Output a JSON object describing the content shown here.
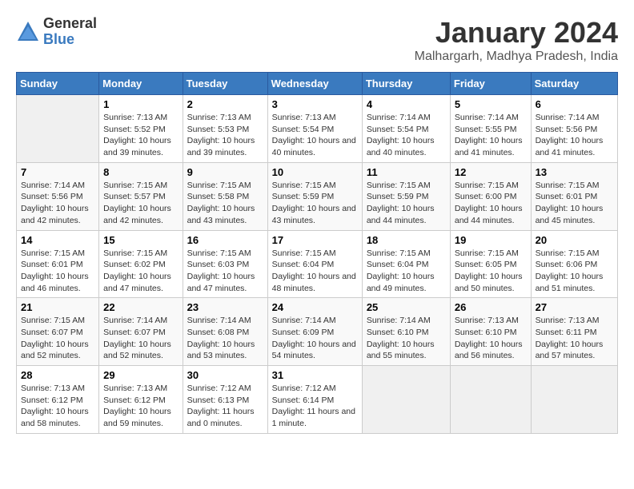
{
  "logo": {
    "general": "General",
    "blue": "Blue"
  },
  "title": "January 2024",
  "subtitle": "Malhargarh, Madhya Pradesh, India",
  "headers": [
    "Sunday",
    "Monday",
    "Tuesday",
    "Wednesday",
    "Thursday",
    "Friday",
    "Saturday"
  ],
  "weeks": [
    [
      {
        "day": "",
        "sunrise": "",
        "sunset": "",
        "daylight": ""
      },
      {
        "day": "1",
        "sunrise": "Sunrise: 7:13 AM",
        "sunset": "Sunset: 5:52 PM",
        "daylight": "Daylight: 10 hours and 39 minutes."
      },
      {
        "day": "2",
        "sunrise": "Sunrise: 7:13 AM",
        "sunset": "Sunset: 5:53 PM",
        "daylight": "Daylight: 10 hours and 39 minutes."
      },
      {
        "day": "3",
        "sunrise": "Sunrise: 7:13 AM",
        "sunset": "Sunset: 5:54 PM",
        "daylight": "Daylight: 10 hours and 40 minutes."
      },
      {
        "day": "4",
        "sunrise": "Sunrise: 7:14 AM",
        "sunset": "Sunset: 5:54 PM",
        "daylight": "Daylight: 10 hours and 40 minutes."
      },
      {
        "day": "5",
        "sunrise": "Sunrise: 7:14 AM",
        "sunset": "Sunset: 5:55 PM",
        "daylight": "Daylight: 10 hours and 41 minutes."
      },
      {
        "day": "6",
        "sunrise": "Sunrise: 7:14 AM",
        "sunset": "Sunset: 5:56 PM",
        "daylight": "Daylight: 10 hours and 41 minutes."
      }
    ],
    [
      {
        "day": "7",
        "sunrise": "Sunrise: 7:14 AM",
        "sunset": "Sunset: 5:56 PM",
        "daylight": "Daylight: 10 hours and 42 minutes."
      },
      {
        "day": "8",
        "sunrise": "Sunrise: 7:15 AM",
        "sunset": "Sunset: 5:57 PM",
        "daylight": "Daylight: 10 hours and 42 minutes."
      },
      {
        "day": "9",
        "sunrise": "Sunrise: 7:15 AM",
        "sunset": "Sunset: 5:58 PM",
        "daylight": "Daylight: 10 hours and 43 minutes."
      },
      {
        "day": "10",
        "sunrise": "Sunrise: 7:15 AM",
        "sunset": "Sunset: 5:59 PM",
        "daylight": "Daylight: 10 hours and 43 minutes."
      },
      {
        "day": "11",
        "sunrise": "Sunrise: 7:15 AM",
        "sunset": "Sunset: 5:59 PM",
        "daylight": "Daylight: 10 hours and 44 minutes."
      },
      {
        "day": "12",
        "sunrise": "Sunrise: 7:15 AM",
        "sunset": "Sunset: 6:00 PM",
        "daylight": "Daylight: 10 hours and 44 minutes."
      },
      {
        "day": "13",
        "sunrise": "Sunrise: 7:15 AM",
        "sunset": "Sunset: 6:01 PM",
        "daylight": "Daylight: 10 hours and 45 minutes."
      }
    ],
    [
      {
        "day": "14",
        "sunrise": "Sunrise: 7:15 AM",
        "sunset": "Sunset: 6:01 PM",
        "daylight": "Daylight: 10 hours and 46 minutes."
      },
      {
        "day": "15",
        "sunrise": "Sunrise: 7:15 AM",
        "sunset": "Sunset: 6:02 PM",
        "daylight": "Daylight: 10 hours and 47 minutes."
      },
      {
        "day": "16",
        "sunrise": "Sunrise: 7:15 AM",
        "sunset": "Sunset: 6:03 PM",
        "daylight": "Daylight: 10 hours and 47 minutes."
      },
      {
        "day": "17",
        "sunrise": "Sunrise: 7:15 AM",
        "sunset": "Sunset: 6:04 PM",
        "daylight": "Daylight: 10 hours and 48 minutes."
      },
      {
        "day": "18",
        "sunrise": "Sunrise: 7:15 AM",
        "sunset": "Sunset: 6:04 PM",
        "daylight": "Daylight: 10 hours and 49 minutes."
      },
      {
        "day": "19",
        "sunrise": "Sunrise: 7:15 AM",
        "sunset": "Sunset: 6:05 PM",
        "daylight": "Daylight: 10 hours and 50 minutes."
      },
      {
        "day": "20",
        "sunrise": "Sunrise: 7:15 AM",
        "sunset": "Sunset: 6:06 PM",
        "daylight": "Daylight: 10 hours and 51 minutes."
      }
    ],
    [
      {
        "day": "21",
        "sunrise": "Sunrise: 7:15 AM",
        "sunset": "Sunset: 6:07 PM",
        "daylight": "Daylight: 10 hours and 52 minutes."
      },
      {
        "day": "22",
        "sunrise": "Sunrise: 7:14 AM",
        "sunset": "Sunset: 6:07 PM",
        "daylight": "Daylight: 10 hours and 52 minutes."
      },
      {
        "day": "23",
        "sunrise": "Sunrise: 7:14 AM",
        "sunset": "Sunset: 6:08 PM",
        "daylight": "Daylight: 10 hours and 53 minutes."
      },
      {
        "day": "24",
        "sunrise": "Sunrise: 7:14 AM",
        "sunset": "Sunset: 6:09 PM",
        "daylight": "Daylight: 10 hours and 54 minutes."
      },
      {
        "day": "25",
        "sunrise": "Sunrise: 7:14 AM",
        "sunset": "Sunset: 6:10 PM",
        "daylight": "Daylight: 10 hours and 55 minutes."
      },
      {
        "day": "26",
        "sunrise": "Sunrise: 7:13 AM",
        "sunset": "Sunset: 6:10 PM",
        "daylight": "Daylight: 10 hours and 56 minutes."
      },
      {
        "day": "27",
        "sunrise": "Sunrise: 7:13 AM",
        "sunset": "Sunset: 6:11 PM",
        "daylight": "Daylight: 10 hours and 57 minutes."
      }
    ],
    [
      {
        "day": "28",
        "sunrise": "Sunrise: 7:13 AM",
        "sunset": "Sunset: 6:12 PM",
        "daylight": "Daylight: 10 hours and 58 minutes."
      },
      {
        "day": "29",
        "sunrise": "Sunrise: 7:13 AM",
        "sunset": "Sunset: 6:12 PM",
        "daylight": "Daylight: 10 hours and 59 minutes."
      },
      {
        "day": "30",
        "sunrise": "Sunrise: 7:12 AM",
        "sunset": "Sunset: 6:13 PM",
        "daylight": "Daylight: 11 hours and 0 minutes."
      },
      {
        "day": "31",
        "sunrise": "Sunrise: 7:12 AM",
        "sunset": "Sunset: 6:14 PM",
        "daylight": "Daylight: 11 hours and 1 minute."
      },
      {
        "day": "",
        "sunrise": "",
        "sunset": "",
        "daylight": ""
      },
      {
        "day": "",
        "sunrise": "",
        "sunset": "",
        "daylight": ""
      },
      {
        "day": "",
        "sunrise": "",
        "sunset": "",
        "daylight": ""
      }
    ]
  ]
}
